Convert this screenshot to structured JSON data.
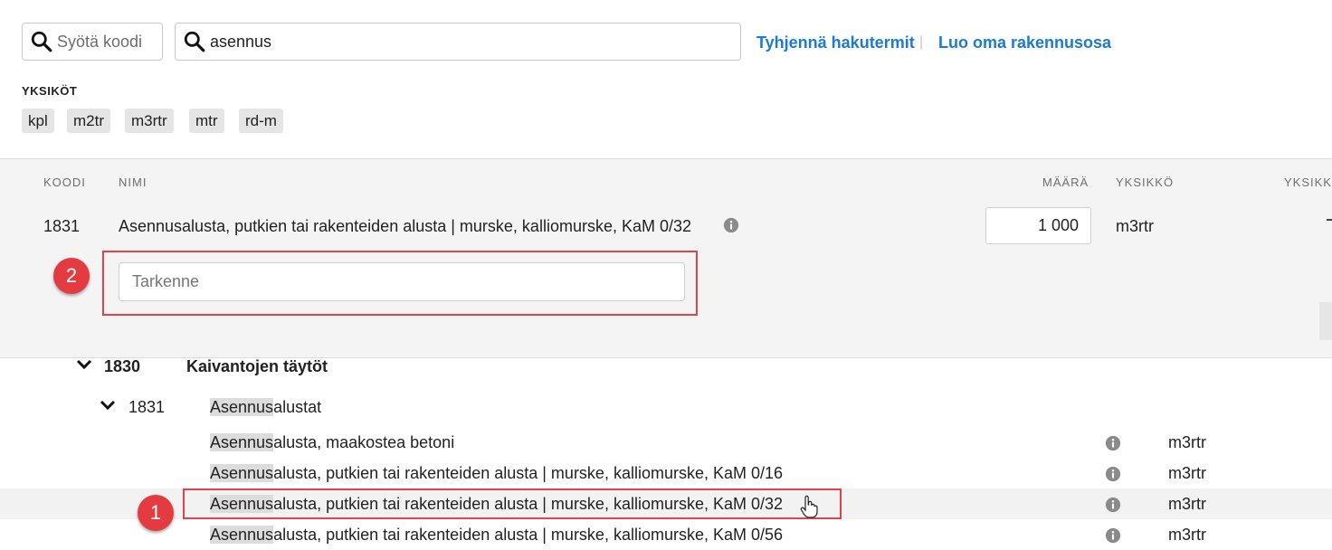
{
  "search": {
    "code_placeholder": "Syötä koodi",
    "term_value": "asennus",
    "clear_label": "Tyhjennä hakutermit",
    "separator": "|",
    "create_label": "Luo oma rakennusosa"
  },
  "units": {
    "title": "YKSIKÖT",
    "chips": [
      "kpl",
      "m2tr",
      "m3rtr",
      "mtr",
      "rd-m"
    ]
  },
  "table_header": {
    "code": "KOODI",
    "name": "NIMI",
    "amount": "MÄÄRÄ",
    "unit": "YKSIKKÖ",
    "unit_price": "YKSIKK"
  },
  "selected": {
    "code": "1831",
    "name": "Asennusalusta, putkien tai rakenteiden alusta | murske, kalliomurske, KaM 0/32",
    "amount": "1 000",
    "unit": "m3rtr",
    "spec_placeholder": "Tarkenne"
  },
  "annotations": {
    "badge1": "1",
    "badge2": "2"
  },
  "tree": {
    "group": {
      "code": "1830",
      "name": "Kaivantojen täytöt"
    },
    "subgroup": {
      "code": "1831",
      "highlight": "Asennus",
      "rest": "alustat"
    },
    "items": [
      {
        "highlight": "Asennus",
        "rest": "alusta, maakostea betoni",
        "unit": "m3rtr"
      },
      {
        "highlight": "Asennus",
        "rest": "alusta, putkien tai rakenteiden alusta | murske, kalliomurske, KaM 0/16",
        "unit": "m3rtr"
      },
      {
        "highlight": "Asennus",
        "rest": "alusta, putkien tai rakenteiden alusta | murske, kalliomurske, KaM 0/32",
        "unit": "m3rtr"
      },
      {
        "highlight": "Asennus",
        "rest": "alusta, putkien tai rakenteiden alusta | murske, kalliomurske, KaM 0/56",
        "unit": "m3rtr"
      }
    ]
  },
  "colors": {
    "link": "#1a7ad6",
    "annotation_red": "#e33b3f",
    "highlight": "#dcdcdc",
    "panel_bg": "#f4f4f4"
  }
}
